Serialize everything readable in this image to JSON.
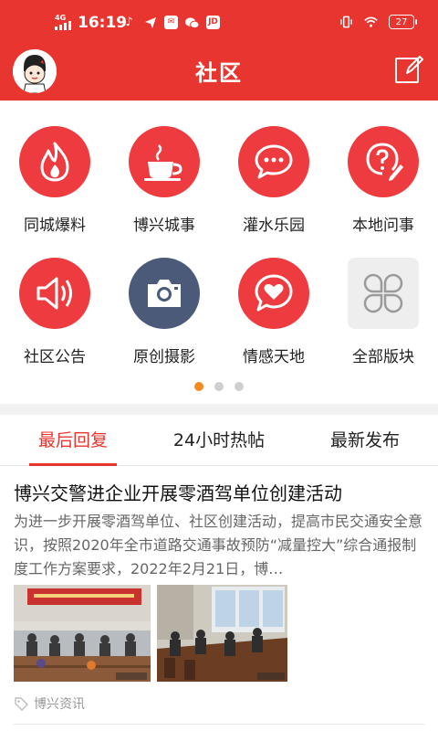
{
  "status_bar": {
    "network": "4G",
    "time": "16:19",
    "battery": "27"
  },
  "header": {
    "title": "社区"
  },
  "colors": {
    "brand_red": "#e8352f",
    "icon_red": "#ee3b3f",
    "camera_slate": "#4a5a78",
    "active_dot": "#f58b1e"
  },
  "grid": {
    "items": [
      {
        "label": "同城爆料",
        "icon": "flame-icon"
      },
      {
        "label": "博兴城事",
        "icon": "coffee-cup-icon"
      },
      {
        "label": "灌水乐园",
        "icon": "chat-bubble-icon"
      },
      {
        "label": "本地问事",
        "icon": "question-pen-icon"
      },
      {
        "label": "社区公告",
        "icon": "speaker-icon"
      },
      {
        "label": "原创摄影",
        "icon": "camera-icon"
      },
      {
        "label": "情感天地",
        "icon": "heart-bubble-icon"
      },
      {
        "label": "全部版块",
        "icon": "four-leaf-grid-icon"
      }
    ],
    "pages": 3,
    "current_page": 1
  },
  "tabs": [
    {
      "label": "最后回复",
      "active": true
    },
    {
      "label": "24小时热帖",
      "active": false
    },
    {
      "label": "最新发布",
      "active": false
    }
  ],
  "article": {
    "title": "博兴交警进企业开展零酒驾单位创建活动",
    "summary": "为进一步开展零酒驾单位、社区创建活动，提高市民交通安全意识，按照2020年全市道路交通事故预防“减量控大”综合通报制度工作方案要求，2022年2月21日，博…",
    "tag": "博兴资讯"
  }
}
